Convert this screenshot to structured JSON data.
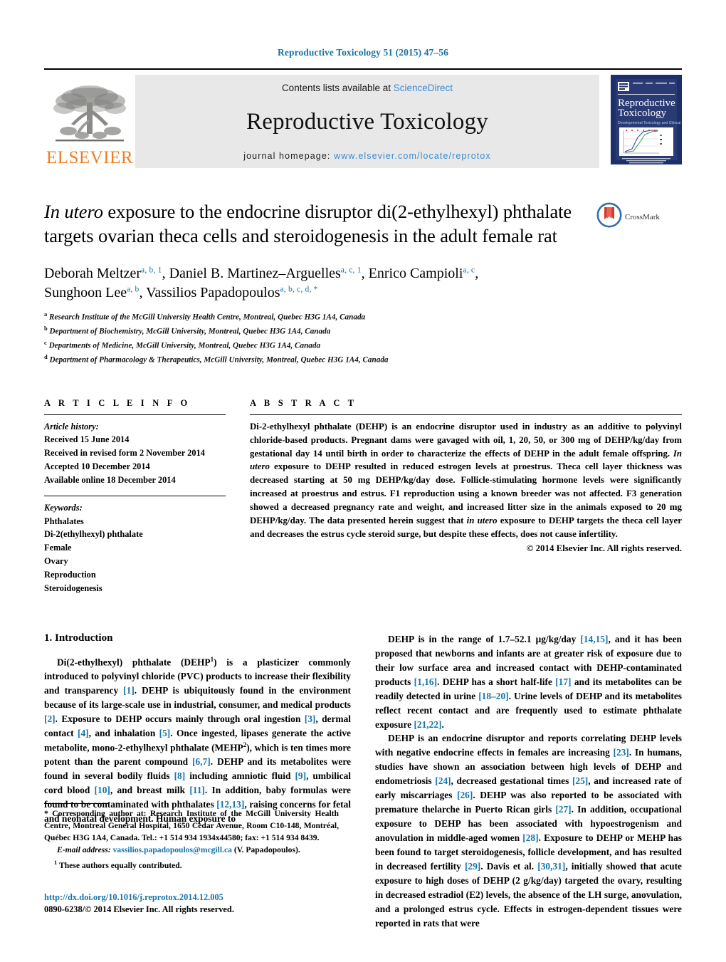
{
  "running_head": "Reproductive Toxicology 51 (2015) 47–56",
  "banner": {
    "publisher_name": "ELSEVIER",
    "publisher_logo_icon": "elsevier-tree-icon",
    "contents_prefix": "Contents lists available at ",
    "contents_link": "ScienceDirect",
    "journal_title": "Reproductive Toxicology",
    "homepage_prefix": "journal homepage: ",
    "homepage_url": "www.elsevier.com/locate/reprotox",
    "cover": {
      "line1": "Reproductive",
      "line2": "Toxicology",
      "subtitle": "Developmental Toxicology and Clinical Sciences"
    }
  },
  "article": {
    "title_part1_italic": "In utero",
    "title_rest": " exposure to the endocrine disruptor di(2-ethylhexyl) phthalate targets ovarian theca cells and steroidogenesis in the adult female rat",
    "crossmark_label": "CrossMark",
    "crossmark_icon": "crossmark-icon"
  },
  "authors": {
    "list": [
      {
        "name": "Deborah Meltzer",
        "sup": "a, b, 1"
      },
      {
        "name": "Daniel B. Martinez–Arguelles",
        "sup": "a, c, 1"
      },
      {
        "name": "Enrico Campioli",
        "sup": "a, c"
      },
      {
        "name": "Sunghoon Lee",
        "sup": "a, b"
      },
      {
        "name": "Vassilios Papadopoulos",
        "sup": "a, b, c, d, *"
      }
    ],
    "affiliations": [
      {
        "key": "a",
        "text": "Research Institute of the McGill University Health Centre, Montreal, Quebec H3G 1A4, Canada"
      },
      {
        "key": "b",
        "text": "Department of Biochemistry, McGill University, Montreal, Quebec H3G 1A4, Canada"
      },
      {
        "key": "c",
        "text": "Departments of Medicine, McGill University, Montreal, Quebec H3G 1A4, Canada"
      },
      {
        "key": "d",
        "text": "Department of Pharmacology & Therapeutics, McGill University, Montreal, Quebec H3G 1A4, Canada"
      }
    ]
  },
  "article_info": {
    "heading": "A R T I C L E   I N F O",
    "history_label": "Article history:",
    "history": [
      "Received 15 June 2014",
      "Received in revised form 2 November 2014",
      "Accepted 10 December 2014",
      "Available online 18 December 2014"
    ],
    "keywords_label": "Keywords:",
    "keywords": [
      "Phthalates",
      "Di-2(ethylhexyl) phthalate",
      "Female",
      "Ovary",
      "Reproduction",
      "Steroidogenesis"
    ]
  },
  "abstract": {
    "heading": "A B S T R A C T",
    "text_1": "Di-2-ethylhexyl phthalate (DEHP) is an endocrine disruptor used in industry as an additive to polyvinyl chloride-based products. Pregnant dams were gavaged with oil, 1, 20, 50, or 300 mg of DEHP/kg/day from gestational day 14 until birth in order to characterize the effects of DEHP in the adult female offspring. ",
    "italic_1": "In utero",
    "text_2": " exposure to DEHP resulted in reduced estrogen levels at proestrus. Theca cell layer thickness was decreased starting at 50 mg DEHP/kg/day dose. Follicle-stimulating hormone levels were significantly increased at proestrus and estrus. F1 reproduction using a known breeder was not affected. F3 generation showed a decreased pregnancy rate and weight, and increased litter size in the animals exposed to 20 mg DEHP/kg/day. The data presented herein suggest that ",
    "italic_2": "in utero",
    "text_3": " exposure to DEHP targets the theca cell layer and decreases the estrus cycle steroid surge, but despite these effects, does not cause infertility.",
    "copyright": "© 2014 Elsevier Inc. All rights reserved."
  },
  "intro": {
    "heading": "1.  Introduction",
    "left_para_1": "Di(2-ethylhexyl) phthalate (DEHP",
    "left_para_1_sup": "1",
    "left_para_1b": ") is a plasticizer commonly introduced to polyvinyl chloride (PVC) products to increase their flexibility and transparency [1]. DEHP is ubiquitously found in the environment because of its large-scale use in industrial, consumer, and medical products [2]. Exposure to DEHP occurs mainly through oral ingestion [3], dermal contact [4], and inhalation [5]. Once ingested, lipases generate the active metabolite, mono-2-ethylhexyl phthalate (MEHP",
    "left_para_1_sup2": "2",
    "left_para_1c": "), which is ten times more potent than the parent compound [6,7]. DEHP and its metabolites were found in several bodily fluids [8] including amniotic fluid [9], umbilical cord blood [10], and breast milk [11]. In addition, baby formulas were found to be contaminated with phthalates [12,13], raising concerns for fetal and neonatal development. Human exposure to",
    "right_para_1": "DEHP is in the range of 1.7–52.1 μg/kg/day [14,15], and it has been proposed that newborns and infants are at greater risk of exposure due to their low surface area and increased contact with DEHP-contaminated products [1,16]. DEHP has a short half-life [17] and its metabolites can be readily detected in urine [18–20]. Urine levels of DEHP and its metabolites reflect recent contact and are frequently used to estimate phthalate exposure [21,22].",
    "right_para_2": "DEHP is an endocrine disruptor and reports correlating DEHP levels with negative endocrine effects in females are increasing [23]. In humans, studies have shown an association between high levels of DEHP and endometriosis [24], decreased gestational times [25], and increased rate of early miscarriages [26]. DEHP was also reported to be associated with premature thelarche in Puerto Rican girls [27]. In addition, occupational exposure to DEHP has been associated with hypoestrogenism and anovulation in middle-aged women [28]. Exposure to DEHP or MEHP has been found to target steroidogenesis, follicle development, and has resulted in decreased fertility [29]. Davis et al. [30,31], initially showed that acute exposure to high doses of DEHP (2 g/kg/day) targeted the ovary, resulting in decreased estradiol (E2) levels, the absence of the LH surge, anovulation, and a prolonged estrus cycle. Effects in estrogen-dependent tissues were reported in rats that were"
  },
  "footnotes": {
    "corresponding": "* Corresponding author at: Research Institute of the McGill University Health Centre, Montreal General Hospital, 1650 Cedar Avenue, Room C10-148, Montréal, Québec H3G 1A4, Canada. Tel.: +1 514 934 1934x44580; fax: +1 514 934 8439.",
    "email_label": "E-mail address:",
    "email": "vassilios.papadopoulos@mcgill.ca",
    "email_suffix": " (V. Papadopoulos).",
    "equal_contrib_sup": "1",
    "equal_contrib": "These authors equally contributed.",
    "doi": "http://dx.doi.org/10.1016/j.reprotox.2014.12.005",
    "issn": "0890-6238/© 2014 Elsevier Inc. All rights reserved."
  },
  "colors": {
    "link_blue": "#1673a8",
    "banner_link_blue": "#3a8bd0",
    "elsevier_orange": "#ef7d22",
    "banner_gray": "#e8e8e8"
  }
}
